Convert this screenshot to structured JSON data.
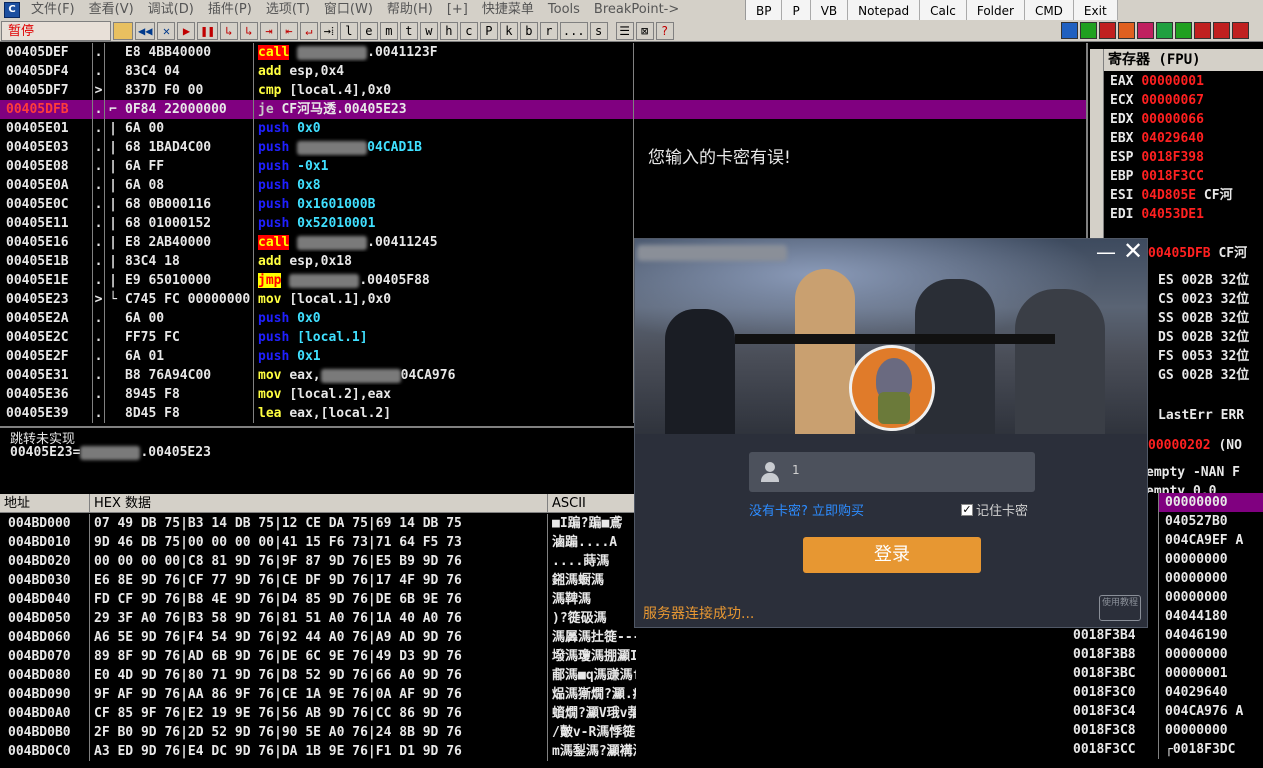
{
  "menu": {
    "items": [
      "文件(F)",
      "查看(V)",
      "调试(D)",
      "插件(P)",
      "选项(T)",
      "窗口(W)",
      "帮助(H)",
      "[+]",
      "快捷菜单",
      "Tools",
      "BreakPoint->"
    ]
  },
  "plugins": {
    "items": [
      "BP",
      "P",
      "VB",
      "Notepad",
      "Calc",
      "Folder",
      "CMD",
      "Exit"
    ]
  },
  "toolbar": {
    "state": "暂停",
    "buttons": [
      "◀◀",
      "✕",
      "▶",
      "❚❚",
      "↳",
      "↳",
      "⇥",
      "⇤",
      "↵",
      "→⁞",
      "l",
      "e",
      "m",
      "t",
      "w",
      "h",
      "c",
      "P",
      "k",
      "b",
      "r",
      "...",
      "s",
      "☰",
      "⊠",
      "?"
    ],
    "color_icons": [
      "#2060c0",
      "#20a020",
      "#c02020",
      "#e06020",
      "#c02060",
      "#20a040",
      "#20a020",
      "#c02020",
      "#c02020",
      "#c02020"
    ]
  },
  "disasm": {
    "rows": [
      {
        "addr": "00405DEF",
        "mk": ".",
        "gut": "",
        "hex": "E8 4BB40000",
        "op": "call",
        "opclass": "op-call",
        "operand": ".0041123F",
        "blurred": true
      },
      {
        "addr": "00405DF4",
        "mk": ".",
        "gut": "",
        "hex": "83C4 04",
        "op": "add",
        "opclass": "op-add",
        "operand": "esp,0x4",
        "blurred": false
      },
      {
        "addr": "00405DF7",
        "mk": ">",
        "gut": "",
        "hex": "837D F0 00",
        "op": "cmp",
        "opclass": "op-cmp",
        "operand": "[local.4],0x0",
        "blurred": false
      },
      {
        "addr": "00405DFB",
        "mk": ".",
        "gut": "⌐",
        "hex": "0F84 22000000",
        "op": "je",
        "opclass": "op-je",
        "operand": "CF河马透.00405E23",
        "blurred": false,
        "selected": true
      },
      {
        "addr": "00405E01",
        "mk": ".",
        "gut": "|",
        "hex": "6A 00",
        "op": "push",
        "opclass": "op-push",
        "operand": "0x0",
        "blurred": false
      },
      {
        "addr": "00405E03",
        "mk": ".",
        "gut": "|",
        "hex": "68 1BAD4C00",
        "op": "push",
        "opclass": "op-push",
        "operand": "04CAD1B",
        "blurred": true
      },
      {
        "addr": "00405E08",
        "mk": ".",
        "gut": "|",
        "hex": "6A FF",
        "op": "push",
        "opclass": "op-push",
        "operand": "-0x1",
        "blurred": false
      },
      {
        "addr": "00405E0A",
        "mk": ".",
        "gut": "|",
        "hex": "6A 08",
        "op": "push",
        "opclass": "op-push",
        "operand": "0x8",
        "blurred": false
      },
      {
        "addr": "00405E0C",
        "mk": ".",
        "gut": "|",
        "hex": "68 0B000116",
        "op": "push",
        "opclass": "op-push",
        "operand": "0x1601000B",
        "blurred": false
      },
      {
        "addr": "00405E11",
        "mk": ".",
        "gut": "|",
        "hex": "68 01000152",
        "op": "push",
        "opclass": "op-push",
        "operand": "0x52010001",
        "blurred": false
      },
      {
        "addr": "00405E16",
        "mk": ".",
        "gut": "|",
        "hex": "E8 2AB40000",
        "op": "call",
        "opclass": "op-call",
        "operand": ".00411245",
        "blurred": true
      },
      {
        "addr": "00405E1B",
        "mk": ".",
        "gut": "|",
        "hex": "83C4 18",
        "op": "add",
        "opclass": "op-add",
        "operand": "esp,0x18",
        "blurred": false
      },
      {
        "addr": "00405E1E",
        "mk": ".",
        "gut": "|",
        "hex": "E9 65010000",
        "op": "jmp",
        "opclass": "op-jmp",
        "operand": ".00405F88",
        "blurred": true
      },
      {
        "addr": "00405E23",
        "mk": ">",
        "gut": "└",
        "hex": "C745 FC 00000000",
        "op": "mov",
        "opclass": "op-mov",
        "operand": "[local.1],0x0",
        "blurred": false
      },
      {
        "addr": "00405E2A",
        "mk": ".",
        "gut": "",
        "hex": "6A 00",
        "op": "push",
        "opclass": "op-push",
        "operand": "0x0",
        "blurred": false
      },
      {
        "addr": "00405E2C",
        "mk": ".",
        "gut": "",
        "hex": "FF75 FC",
        "op": "push",
        "opclass": "op-push",
        "operand": "[local.1]",
        "blurred": false
      },
      {
        "addr": "00405E2F",
        "mk": ".",
        "gut": "",
        "hex": "6A 01",
        "op": "push",
        "opclass": "op-push",
        "operand": "0x1",
        "blurred": false
      },
      {
        "addr": "00405E31",
        "mk": ".",
        "gut": "",
        "hex": "B8 76A94C00",
        "op": "mov",
        "opclass": "op-mov",
        "operand": "eax,",
        "blurred": true,
        "tail": "04CA976"
      },
      {
        "addr": "00405E36",
        "mk": ".",
        "gut": "",
        "hex": "8945 F8",
        "op": "mov",
        "opclass": "op-mov",
        "operand": "[local.2],eax",
        "blurred": false
      },
      {
        "addr": "00405E39",
        "mk": ".",
        "gut": "",
        "hex": "8D45 F8",
        "op": "lea",
        "opclass": "op-lea",
        "operand": "eax,[local.2]",
        "blurred": false
      }
    ],
    "comment": "您输入的卡密有误!"
  },
  "info": {
    "line1": "跳转未实现",
    "line2_prefix": "00405E23=",
    "line2_suffix": ".00405E23"
  },
  "dump": {
    "headers": {
      "addr": "地址",
      "hex": "HEX 数据",
      "ascii": "ASCII"
    },
    "rows": [
      {
        "addr": "004BD000",
        "hex": "07 49 DB 75|B3 14 DB 75|12 CE DA 75|69 14 DB 75",
        "ascii": "■I蹁?蹁■鳶"
      },
      {
        "addr": "004BD010",
        "hex": "9D 46 DB 75|00 00 00 00|41 15 F6 73|71 64 F5 73",
        "ascii": "滷蹁....A"
      },
      {
        "addr": "004BD020",
        "hex": "00 00 00 00|C8 81 9D 76|9F 87 9D 76|E5 B9 9D 76",
        "ascii": "....蒔溤"
      },
      {
        "addr": "004BD030",
        "hex": "E6 8E 9D 76|CF 77 9D 76|CE DF 9D 76|17 4F 9D 76",
        "ascii": "鎺溤蟵溤"
      },
      {
        "addr": "004BD040",
        "hex": "FD CF 9D 76|B8 4E 9D 76|D4 85 9D 76|DE 6B 9E 76",
        "ascii": " 溤鞞溤"
      },
      {
        "addr": "004BD050",
        "hex": "29 3F A0 76|B3 58 9D 76|81 51 A0 76|1A 40 A0 76",
        "ascii": ")?簁砐溤"
      },
      {
        "addr": "004BD060",
        "hex": "A6 5E 9D 76|F4 54 9D 76|92 44 A0 76|A9 AD 9D 76",
        "ascii": " 溤羼溤扗簁---溤"
      },
      {
        "addr": "004BD070",
        "hex": "89 8F 9D 76|AD 6B 9D 76|DE 6C 9E 76|49 D3 9D 76",
        "ascii": "墢溤瓊溤掤灦I訚v"
      },
      {
        "addr": "004BD080",
        "hex": "E0 4D 9D 76|80 71 9D 76|D8 52 9D 76|66 A0 9D 76",
        "ascii": "郙溤■q溤豏溤f牆v"
      },
      {
        "addr": "004BD090",
        "hex": "9F AF 9D 76|AA 86 9F 76|CE 1A 9E 76|0A AF 9D 76",
        "ascii": "煰溤獑燗?灦.瘽v"
      },
      {
        "addr": "004BD0A0",
        "hex": "CF 85 9F 76|E2 19 9E 76|56 AB 9D 76|CC 86 9D 76",
        "ascii": "蠀燗?灦V珴v虇溤"
      },
      {
        "addr": "004BD0B0",
        "hex": "2F B0 9D 76|2D 52 9D 76|90 5E A0 76|24 8B 9D 76",
        "ascii": "/皾v-R溤悸簁$媿v"
      },
      {
        "addr": "004BD0C0",
        "hex": "A3 ED 9D 76|E4 DC 9D 76|DA 1B 9E 76|F1 D1 9D 76",
        "ascii": "m溤鋫溤?灦褠溤"
      }
    ]
  },
  "registers": {
    "header": "寄存器 (FPU)",
    "regs": [
      {
        "name": "EAX",
        "value": "00000001",
        "extra": ""
      },
      {
        "name": "ECX",
        "value": "00000067",
        "extra": ""
      },
      {
        "name": "EDX",
        "value": "00000066",
        "extra": ""
      },
      {
        "name": "EBX",
        "value": "04029640",
        "extra": ""
      },
      {
        "name": "ESP",
        "value": "0018F398",
        "extra": ""
      },
      {
        "name": "EBP",
        "value": "0018F3CC",
        "extra": ""
      },
      {
        "name": "ESI",
        "value": "04D805E",
        "extra": "CF河"
      },
      {
        "name": "EDI",
        "value": "04053DE1",
        "extra": ""
      }
    ],
    "eip": {
      "value": "00405DFB",
      "extra": "CF河"
    },
    "segments": [
      "ES 002B 32位",
      "CS 0023 32位",
      "SS 002B 32位",
      "DS 002B 32位",
      "FS 0053 32位",
      "GS 002B 32位"
    ],
    "lasterr": "LastErr ERR",
    "efl": {
      "value": "00000202",
      "extra": "(NO"
    },
    "fpu": [
      "empty -NAN F",
      "empty 0.0"
    ]
  },
  "stack": {
    "rows": [
      {
        "addr": "",
        "value": "00000000",
        "selected": true
      },
      {
        "addr": "",
        "value": "040527B0"
      },
      {
        "addr": "",
        "value": "004CA9EF A"
      },
      {
        "addr": "",
        "value": "00000000"
      },
      {
        "addr": "",
        "value": "00000000"
      },
      {
        "addr": "",
        "value": "00000000"
      },
      {
        "addr": "",
        "value": "04044180"
      },
      {
        "addr": "0018F3B4",
        "value": "04046190"
      },
      {
        "addr": "0018F3B8",
        "value": "00000000"
      },
      {
        "addr": "0018F3BC",
        "value": "00000001"
      },
      {
        "addr": "0018F3C0",
        "value": "04029640"
      },
      {
        "addr": "0018F3C4",
        "value": "004CA976 A"
      },
      {
        "addr": "0018F3C8",
        "value": "00000000"
      },
      {
        "addr": "0018F3CC",
        "value": "┌0018F3DC"
      }
    ]
  },
  "dialog": {
    "username": "1",
    "buy_link": "没有卡密? 立即购买",
    "remember_label": "记住卡密",
    "login_label": "登录",
    "status": "服务器连接成功...",
    "help_label": "使用教程",
    "minimize_glyph": "—",
    "close_glyph": "✕"
  },
  "colors": {
    "selected_row": "#800080",
    "login": "#e79732",
    "link": "#2d8cff",
    "status": "#e79732"
  }
}
